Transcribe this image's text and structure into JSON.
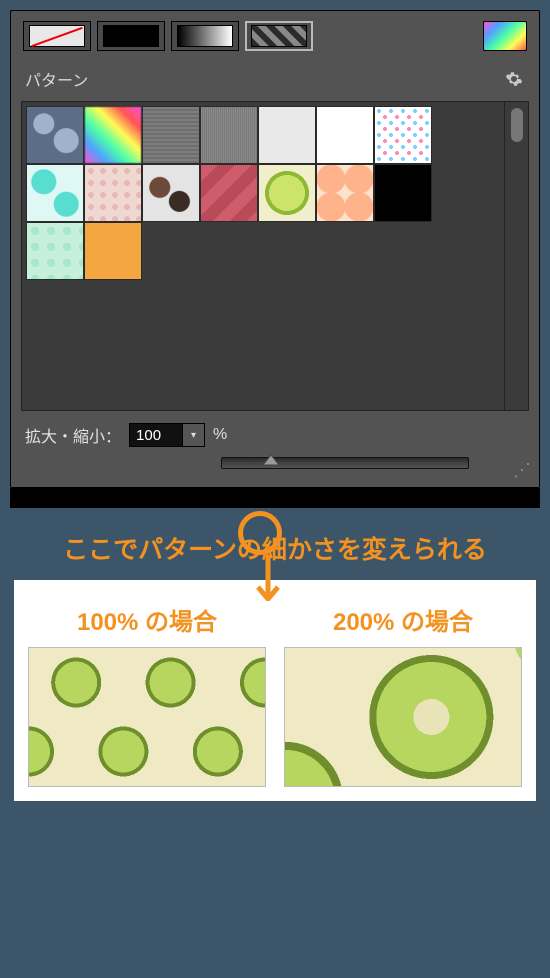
{
  "panel": {
    "section_title": "パターン",
    "fill_modes": [
      "no-fill",
      "solid",
      "gradient",
      "pattern"
    ],
    "selected_fill_mode": "pattern",
    "pattern_names": [
      "bubbles-blue",
      "rainbow-mosaic",
      "noise-dark",
      "noise-fine",
      "paper-light",
      "white",
      "confetti",
      "mint-circles",
      "pink-floral",
      "macarons",
      "chevron-pink",
      "kiwi",
      "citrus-orange",
      "black",
      "mint-dots",
      "orange-solid"
    ],
    "scale": {
      "label": "拡大・縮小：",
      "value": "100",
      "unit": "%"
    }
  },
  "annotation": {
    "caption": "ここでパターンの細かさを変えられる",
    "example_100_label": "100% の場合",
    "example_200_label": "200% の場合"
  }
}
